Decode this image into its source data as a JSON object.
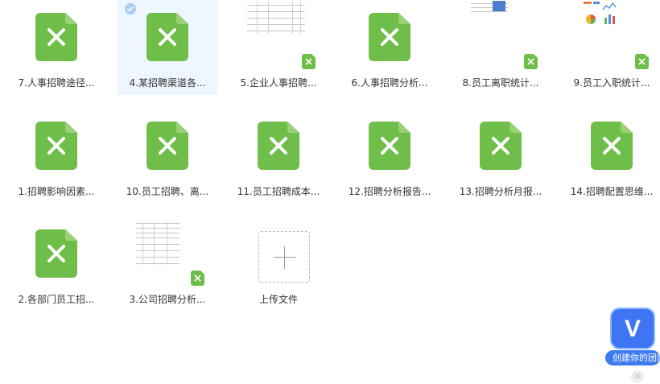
{
  "files": [
    {
      "name": "7.人事招聘途径..."
    },
    {
      "name": "4.某招聘渠道各..."
    },
    {
      "name": "5.企业人事招聘..."
    },
    {
      "name": "6.人事招聘分析..."
    },
    {
      "name": "8.员工离职统计..."
    },
    {
      "name": "9.员工入职统计..."
    },
    {
      "name": "1.招聘影响因素..."
    },
    {
      "name": "10.员工招聘、离..."
    },
    {
      "name": "11.员工招聘成本..."
    },
    {
      "name": "12.招聘分析报告..."
    },
    {
      "name": "13.招聘分析月报..."
    },
    {
      "name": "14.招聘配置思维..."
    },
    {
      "name": "2.各部门员工招..."
    },
    {
      "name": "3.公司招聘分析..."
    }
  ],
  "upload": {
    "label": "上传文件"
  },
  "widget": {
    "logo_letter": "V",
    "label": "创建你的团队"
  },
  "colors": {
    "excel_green": "#6fbe4a",
    "selection": "#eef6ff",
    "widget_blue": "#3e7bf0"
  },
  "icons": {
    "file": "excel-file-icon",
    "check": "check-icon",
    "add": "plus-icon",
    "close": "close-icon"
  }
}
